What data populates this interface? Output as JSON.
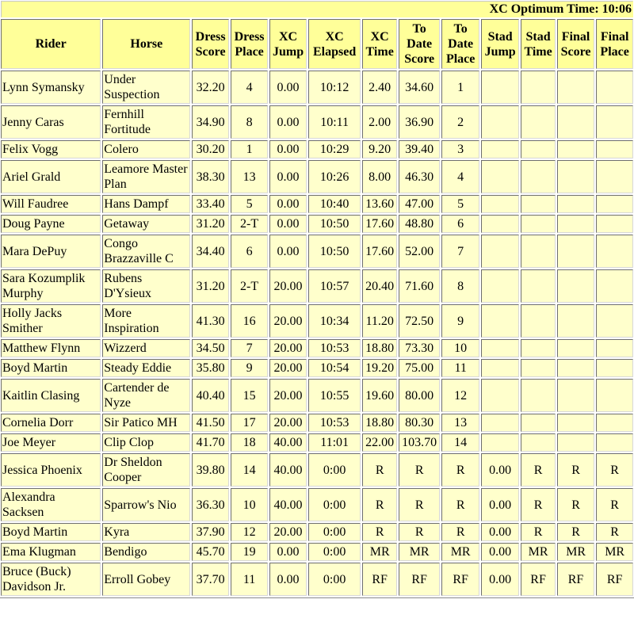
{
  "title": "XC Optimum Time: 10:06",
  "colors": {
    "header_bg": "#ffff99",
    "cell_bg": "#ffffcc"
  },
  "columns": [
    "Rider",
    "Horse",
    "Dress Score",
    "Dress Place",
    "XC Jump",
    "XC Elapsed",
    "XC Time",
    "To Date Score",
    "To Date Place",
    "Stad Jump",
    "Stad Time",
    "Final Score",
    "Final Place"
  ],
  "header_lines": [
    [
      "Rider"
    ],
    [
      "Horse"
    ],
    [
      "Dress",
      "Score"
    ],
    [
      "Dress",
      "Place"
    ],
    [
      "XC",
      "Jump"
    ],
    [
      "XC",
      "Elapsed"
    ],
    [
      "XC",
      "Time"
    ],
    [
      "To",
      "Date",
      "Score"
    ],
    [
      "To",
      "Date",
      "Place"
    ],
    [
      "Stad",
      "Jump"
    ],
    [
      "Stad",
      "Time"
    ],
    [
      "Final",
      "Score"
    ],
    [
      "Final",
      "Place"
    ]
  ],
  "rows": [
    {
      "rider": "Lynn Symansky",
      "horse": "Under Suspection",
      "dress_score": "32.20",
      "dress_place": "4",
      "xc_jump": "0.00",
      "xc_elapsed": "10:12",
      "xc_time": "2.40",
      "to_date_score": "34.60",
      "to_date_place": "1",
      "stad_jump": "",
      "stad_time": "",
      "final_score": "",
      "final_place": "",
      "tall": true
    },
    {
      "rider": "Jenny Caras",
      "horse": "Fernhill Fortitude",
      "dress_score": "34.90",
      "dress_place": "8",
      "xc_jump": "0.00",
      "xc_elapsed": "10:11",
      "xc_time": "2.00",
      "to_date_score": "36.90",
      "to_date_place": "2",
      "stad_jump": "",
      "stad_time": "",
      "final_score": "",
      "final_place": "",
      "tall": true
    },
    {
      "rider": "Felix Vogg",
      "horse": "Colero",
      "dress_score": "30.20",
      "dress_place": "1",
      "xc_jump": "0.00",
      "xc_elapsed": "10:29",
      "xc_time": "9.20",
      "to_date_score": "39.40",
      "to_date_place": "3",
      "stad_jump": "",
      "stad_time": "",
      "final_score": "",
      "final_place": "",
      "tall": false
    },
    {
      "rider": "Ariel Grald",
      "horse": "Leamore Master Plan",
      "dress_score": "38.30",
      "dress_place": "13",
      "xc_jump": "0.00",
      "xc_elapsed": "10:26",
      "xc_time": "8.00",
      "to_date_score": "46.30",
      "to_date_place": "4",
      "stad_jump": "",
      "stad_time": "",
      "final_score": "",
      "final_place": "",
      "tall": true
    },
    {
      "rider": "Will Faudree",
      "horse": "Hans Dampf",
      "dress_score": "33.40",
      "dress_place": "5",
      "xc_jump": "0.00",
      "xc_elapsed": "10:40",
      "xc_time": "13.60",
      "to_date_score": "47.00",
      "to_date_place": "5",
      "stad_jump": "",
      "stad_time": "",
      "final_score": "",
      "final_place": "",
      "tall": false
    },
    {
      "rider": "Doug Payne",
      "horse": "Getaway",
      "dress_score": "31.20",
      "dress_place": "2-T",
      "xc_jump": "0.00",
      "xc_elapsed": "10:50",
      "xc_time": "17.60",
      "to_date_score": "48.80",
      "to_date_place": "6",
      "stad_jump": "",
      "stad_time": "",
      "final_score": "",
      "final_place": "",
      "tall": false
    },
    {
      "rider": "Mara DePuy",
      "horse": "Congo Brazzaville C",
      "dress_score": "34.40",
      "dress_place": "6",
      "xc_jump": "0.00",
      "xc_elapsed": "10:50",
      "xc_time": "17.60",
      "to_date_score": "52.00",
      "to_date_place": "7",
      "stad_jump": "",
      "stad_time": "",
      "final_score": "",
      "final_place": "",
      "tall": true
    },
    {
      "rider": "Sara Kozumplik Murphy",
      "horse": "Rubens D'Ysieux",
      "dress_score": "31.20",
      "dress_place": "2-T",
      "xc_jump": "20.00",
      "xc_elapsed": "10:57",
      "xc_time": "20.40",
      "to_date_score": "71.60",
      "to_date_place": "8",
      "stad_jump": "",
      "stad_time": "",
      "final_score": "",
      "final_place": "",
      "tall": true
    },
    {
      "rider": "Holly Jacks Smither",
      "horse": "More Inspiration",
      "dress_score": "41.30",
      "dress_place": "16",
      "xc_jump": "20.00",
      "xc_elapsed": "10:34",
      "xc_time": "11.20",
      "to_date_score": "72.50",
      "to_date_place": "9",
      "stad_jump": "",
      "stad_time": "",
      "final_score": "",
      "final_place": "",
      "tall": true
    },
    {
      "rider": "Matthew Flynn",
      "horse": "Wizzerd",
      "dress_score": "34.50",
      "dress_place": "7",
      "xc_jump": "20.00",
      "xc_elapsed": "10:53",
      "xc_time": "18.80",
      "to_date_score": "73.30",
      "to_date_place": "10",
      "stad_jump": "",
      "stad_time": "",
      "final_score": "",
      "final_place": "",
      "tall": false
    },
    {
      "rider": "Boyd Martin",
      "horse": "Steady Eddie",
      "dress_score": "35.80",
      "dress_place": "9",
      "xc_jump": "20.00",
      "xc_elapsed": "10:54",
      "xc_time": "19.20",
      "to_date_score": "75.00",
      "to_date_place": "11",
      "stad_jump": "",
      "stad_time": "",
      "final_score": "",
      "final_place": "",
      "tall": false
    },
    {
      "rider": "Kaitlin Clasing",
      "horse": "Cartender de Nyze",
      "dress_score": "40.40",
      "dress_place": "15",
      "xc_jump": "20.00",
      "xc_elapsed": "10:55",
      "xc_time": "19.60",
      "to_date_score": "80.00",
      "to_date_place": "12",
      "stad_jump": "",
      "stad_time": "",
      "final_score": "",
      "final_place": "",
      "tall": true
    },
    {
      "rider": "Cornelia Dorr",
      "horse": "Sir Patico MH",
      "dress_score": "41.50",
      "dress_place": "17",
      "xc_jump": "20.00",
      "xc_elapsed": "10:53",
      "xc_time": "18.80",
      "to_date_score": "80.30",
      "to_date_place": "13",
      "stad_jump": "",
      "stad_time": "",
      "final_score": "",
      "final_place": "",
      "tall": false
    },
    {
      "rider": "Joe Meyer",
      "horse": "Clip Clop",
      "dress_score": "41.70",
      "dress_place": "18",
      "xc_jump": "40.00",
      "xc_elapsed": "11:01",
      "xc_time": "22.00",
      "to_date_score": "103.70",
      "to_date_place": "14",
      "stad_jump": "",
      "stad_time": "",
      "final_score": "",
      "final_place": "",
      "tall": false
    },
    {
      "rider": "Jessica Phoenix",
      "horse": "Dr Sheldon Cooper",
      "dress_score": "39.80",
      "dress_place": "14",
      "xc_jump": "40.00",
      "xc_elapsed": "0:00",
      "xc_time": "R",
      "to_date_score": "R",
      "to_date_place": "R",
      "stad_jump": "0.00",
      "stad_time": "R",
      "final_score": "R",
      "final_place": "R",
      "tall": true
    },
    {
      "rider": "Alexandra Sacksen",
      "horse": "Sparrow's Nio",
      "dress_score": "36.30",
      "dress_place": "10",
      "xc_jump": "40.00",
      "xc_elapsed": "0:00",
      "xc_time": "R",
      "to_date_score": "R",
      "to_date_place": "R",
      "stad_jump": "0.00",
      "stad_time": "R",
      "final_score": "R",
      "final_place": "R",
      "tall": true
    },
    {
      "rider": "Boyd Martin",
      "horse": "Kyra",
      "dress_score": "37.90",
      "dress_place": "12",
      "xc_jump": "20.00",
      "xc_elapsed": "0:00",
      "xc_time": "R",
      "to_date_score": "R",
      "to_date_place": "R",
      "stad_jump": "0.00",
      "stad_time": "R",
      "final_score": "R",
      "final_place": "R",
      "tall": false
    },
    {
      "rider": "Ema Klugman",
      "horse": "Bendigo",
      "dress_score": "45.70",
      "dress_place": "19",
      "xc_jump": "0.00",
      "xc_elapsed": "0:00",
      "xc_time": "MR",
      "to_date_score": "MR",
      "to_date_place": "MR",
      "stad_jump": "0.00",
      "stad_time": "MR",
      "final_score": "MR",
      "final_place": "MR",
      "tall": false
    },
    {
      "rider": "Bruce (Buck) Davidson Jr.",
      "horse": "Erroll Gobey",
      "dress_score": "37.70",
      "dress_place": "11",
      "xc_jump": "0.00",
      "xc_elapsed": "0:00",
      "xc_time": "RF",
      "to_date_score": "RF",
      "to_date_place": "RF",
      "stad_jump": "0.00",
      "stad_time": "RF",
      "final_score": "RF",
      "final_place": "RF",
      "tall": true
    }
  ]
}
